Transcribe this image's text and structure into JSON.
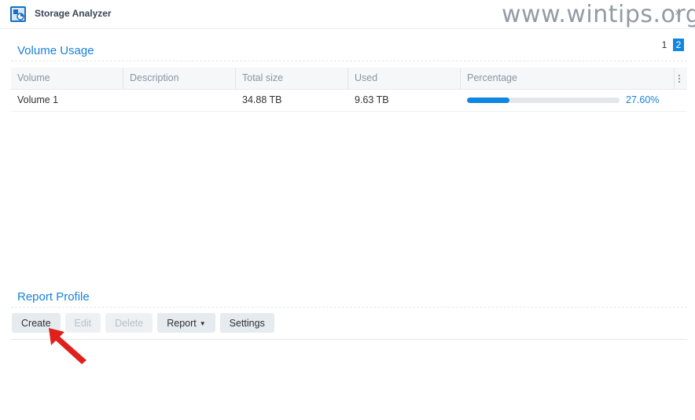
{
  "window": {
    "title": "Storage Analyzer",
    "watermark": "www.wintips.org",
    "close_glyph": "×"
  },
  "pagination": {
    "pages": [
      "1",
      "2"
    ],
    "active": "2"
  },
  "volume_usage": {
    "title": "Volume Usage",
    "columns": [
      "Volume",
      "Description",
      "Total size",
      "Used",
      "Percentage"
    ],
    "rows": [
      {
        "volume": "Volume 1",
        "description": "",
        "total_size": "34.88 TB",
        "used": "9.63 TB",
        "percentage_label": "27.60%",
        "percentage_value": 27.6
      }
    ]
  },
  "report_profile": {
    "title": "Report Profile",
    "buttons": {
      "create": "Create",
      "edit": "Edit",
      "delete": "Delete",
      "report": "Report",
      "settings": "Settings"
    }
  },
  "icons": {
    "app": "storage-analyzer-icon",
    "column_menu": "vertical-dots-icon",
    "dropdown": "caret-down-icon",
    "annotation": "red-arrow-pointer"
  },
  "colors": {
    "accent": "#0f86e0",
    "title_blue": "#1a81d8",
    "annotation_red": "#e0211b"
  }
}
